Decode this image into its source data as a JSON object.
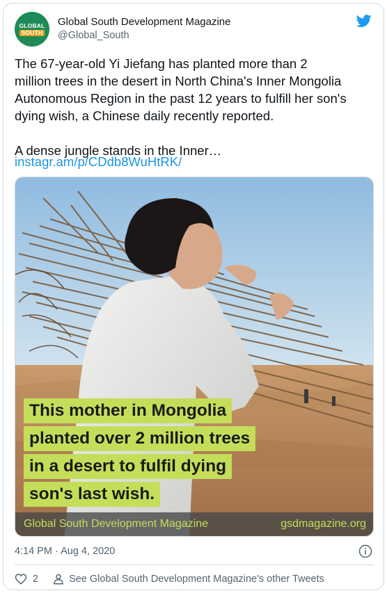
{
  "account": {
    "avatar_line1": "GLOBAL",
    "avatar_line2": "SOUTH",
    "display_name": "Global South Development Magazine",
    "handle": "@Global_South"
  },
  "colors": {
    "link": "#1b95e0",
    "twitter_blue": "#1d9bf0",
    "caption_highlight": "#c5de5a",
    "footer_text": "#c5de5a",
    "avatar_green": "#1e8a57"
  },
  "tweet": {
    "text": "The 67-year-old Yi Jiefang has planted more than 2\nmillion trees in the desert in North China's Inner Mongolia\nAutonomous Region in the past 12 years to fulfill her son's\ndying wish, a Chinese daily recently reported.\n\nA dense jungle stands in the Inner…",
    "link": "instagr.am/p/CDdb8WuHtRK/"
  },
  "media": {
    "caption_lines": [
      "This mother in Mongolia",
      "planted over 2 million trees",
      "in a desert to fulfil dying",
      "son's last wish."
    ],
    "footer_left": "Global South Development Magazine",
    "footer_right": "gsdmagazine.org"
  },
  "meta": {
    "timestamp": "4:14 PM · Aug 4, 2020",
    "like_count": "2",
    "other_tweets": "See Global South Development Magazine's other Tweets"
  },
  "icons": [
    "twitter-bird-icon",
    "info-icon",
    "heart-icon",
    "person-icon"
  ]
}
